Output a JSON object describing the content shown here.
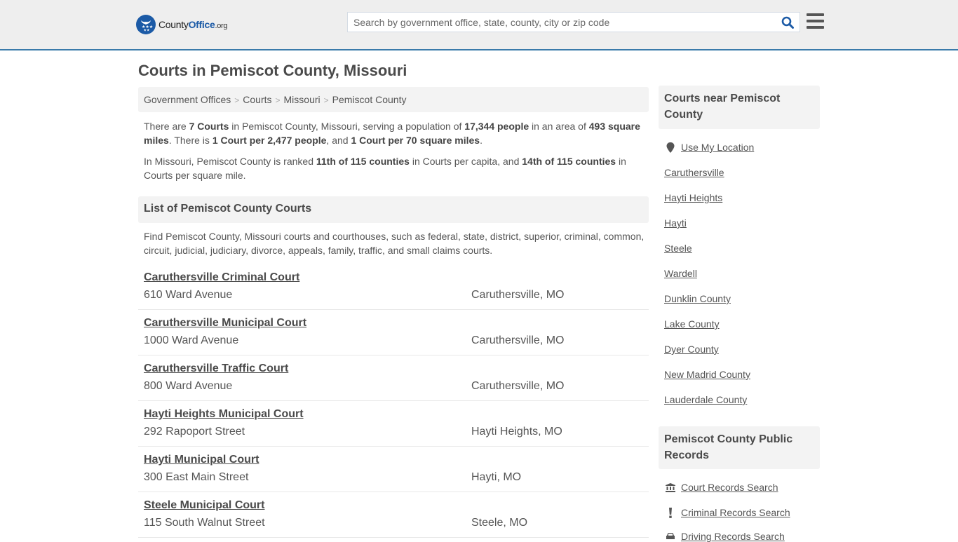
{
  "header": {
    "logo": {
      "text_main": "County",
      "text_brand": "Office",
      "text_tld": ".org",
      "icon": "eagle-stars-badge-icon",
      "brand_color": "#1b5aa6"
    },
    "search": {
      "placeholder": "Search by government office, state, county, city or zip code",
      "value": "",
      "button_icon": "search-icon",
      "icon_color": "#1b5aa6"
    },
    "menu_icon": "hamburger-menu-icon",
    "accent_border_color": "#3a7aaa"
  },
  "main": {
    "title": "Courts in Pemiscot County, Missouri",
    "breadcrumb": [
      "Government Offices",
      "Courts",
      "Missouri",
      "Pemiscot County"
    ],
    "breadcrumb_separator": ">",
    "intro": {
      "p1": {
        "t1": "There are ",
        "b1": "7 Courts",
        "t2": " in Pemiscot County, Missouri, serving a population of ",
        "b2": "17,344 people",
        "t3": " in an area of ",
        "b3": "493 square miles",
        "t4": ". There is ",
        "b4": "1 Court per 2,477 people",
        "t5": ", and ",
        "b5": "1 Court per 70 square miles",
        "t6": "."
      },
      "p2": {
        "t1": "In Missouri, Pemiscot County is ranked ",
        "b1": "11th of 115 counties",
        "t2": " in Courts per capita, and ",
        "b2": "14th of 115 counties",
        "t3": " in Courts per square mile."
      }
    },
    "list_heading": "List of Pemiscot County Courts",
    "list_description": "Find Pemiscot County, Missouri courts and courthouses, such as federal, state, district, superior, criminal, common, circuit, judicial, judiciary, divorce, appeals, family, traffic, and small claims courts.",
    "courts": [
      {
        "name": "Caruthersville Criminal Court",
        "address": "610 Ward Avenue",
        "city": "Caruthersville, MO"
      },
      {
        "name": "Caruthersville Municipal Court",
        "address": "1000 Ward Avenue",
        "city": "Caruthersville, MO"
      },
      {
        "name": "Caruthersville Traffic Court",
        "address": "800 Ward Avenue",
        "city": "Caruthersville, MO"
      },
      {
        "name": "Hayti Heights Municipal Court",
        "address": "292 Rapoport Street",
        "city": "Hayti Heights, MO"
      },
      {
        "name": "Hayti Municipal Court",
        "address": "300 East Main Street",
        "city": "Hayti, MO"
      },
      {
        "name": "Steele Municipal Court",
        "address": "115 South Walnut Street",
        "city": "Steele, MO"
      }
    ]
  },
  "sidebar": {
    "nearby": {
      "heading": "Courts near Pemiscot County",
      "use_location": {
        "label": "Use My Location",
        "icon": "map-marker-icon"
      },
      "links": [
        "Caruthersville",
        "Hayti Heights",
        "Hayti",
        "Steele",
        "Wardell",
        "Dunklin County",
        "Lake County",
        "Dyer County",
        "New Madrid County",
        "Lauderdale County"
      ]
    },
    "records": {
      "heading": "Pemiscot County Public Records",
      "links": [
        {
          "label": "Court Records Search",
          "icon": "courthouse-icon"
        },
        {
          "label": "Criminal Records Search",
          "icon": "exclamation-icon"
        },
        {
          "label": "Driving Records Search",
          "icon": "car-icon"
        }
      ]
    }
  }
}
